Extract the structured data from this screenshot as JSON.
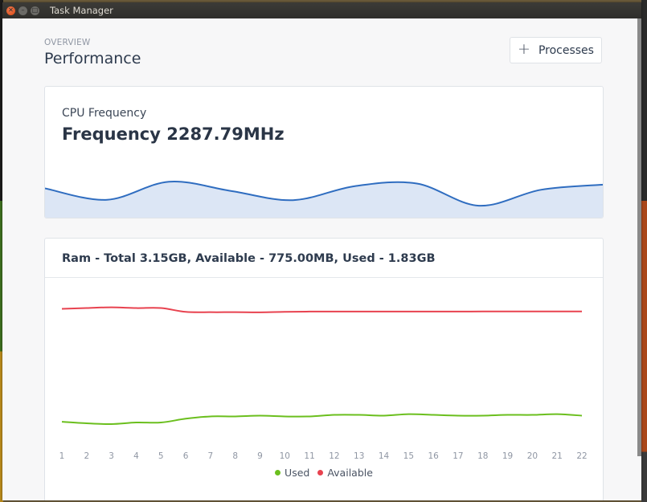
{
  "window": {
    "title": "Task Manager"
  },
  "header": {
    "eyebrow": "OVERVIEW",
    "title": "Performance",
    "processes_button": "Processes"
  },
  "cpu": {
    "label": "CPU Frequency",
    "value": "Frequency 2287.79MHz"
  },
  "ram": {
    "title": "Ram - Total 3.15GB, Available - 775.00MB, Used - 1.83GB"
  },
  "colors": {
    "cpu_line": "#2f6dc0",
    "cpu_fill": "#dce6f5",
    "used": "#6bbf1e",
    "available": "#e8424f",
    "tick": "#8f96a3"
  },
  "chart_data": [
    {
      "type": "area",
      "title": "",
      "x": [
        0,
        1,
        2,
        3,
        4,
        5,
        6,
        7,
        8,
        9,
        10,
        11
      ],
      "series": [
        {
          "values": [
            0.62,
            0.31,
            0.8,
            0.55,
            0.3,
            0.68,
            0.75,
            0.15,
            0.58,
            0.72
          ]
        }
      ]
    },
    {
      "type": "line",
      "xlabel": "",
      "ylabel": "",
      "x": [
        "1",
        "2",
        "3",
        "4",
        "5",
        "6",
        "7",
        "8",
        "9",
        "10",
        "11",
        "12",
        "13",
        "14",
        "15",
        "16",
        "17",
        "18",
        "19",
        "20",
        "21",
        "22"
      ],
      "series": [
        {
          "name": "Used",
          "values": [
            0.11,
            0.1,
            0.095,
            0.105,
            0.105,
            0.13,
            0.145,
            0.145,
            0.15,
            0.145,
            0.145,
            0.155,
            0.155,
            0.15,
            0.16,
            0.155,
            0.15,
            0.15,
            0.155,
            0.155,
            0.16,
            0.15
          ]
        },
        {
          "name": "Available",
          "values": [
            0.85,
            0.855,
            0.86,
            0.855,
            0.855,
            0.83,
            0.828,
            0.828,
            0.827,
            0.83,
            0.832,
            0.832,
            0.832,
            0.832,
            0.832,
            0.832,
            0.832,
            0.833,
            0.833,
            0.833,
            0.833,
            0.833
          ]
        }
      ]
    }
  ]
}
